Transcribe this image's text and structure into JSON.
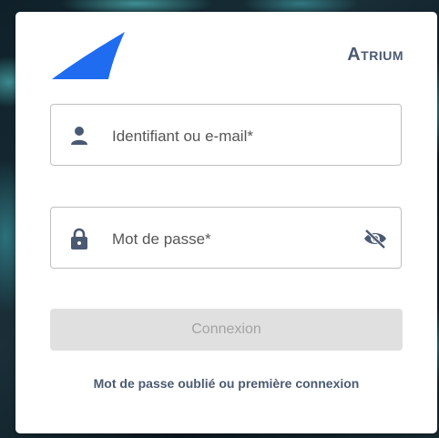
{
  "brand": {
    "name": "Atrium",
    "accent_color": "#1f6cf0"
  },
  "login": {
    "username": {
      "placeholder": "Identifiant ou e-mail*",
      "icon": "person-icon",
      "value": ""
    },
    "password": {
      "placeholder": "Mot de passe*",
      "icon": "lock-icon",
      "toggle_icon": "eye-off-icon",
      "value": ""
    },
    "submit_label": "Connexion",
    "forgot_link": "Mot de passe oublié ou première connexion"
  }
}
